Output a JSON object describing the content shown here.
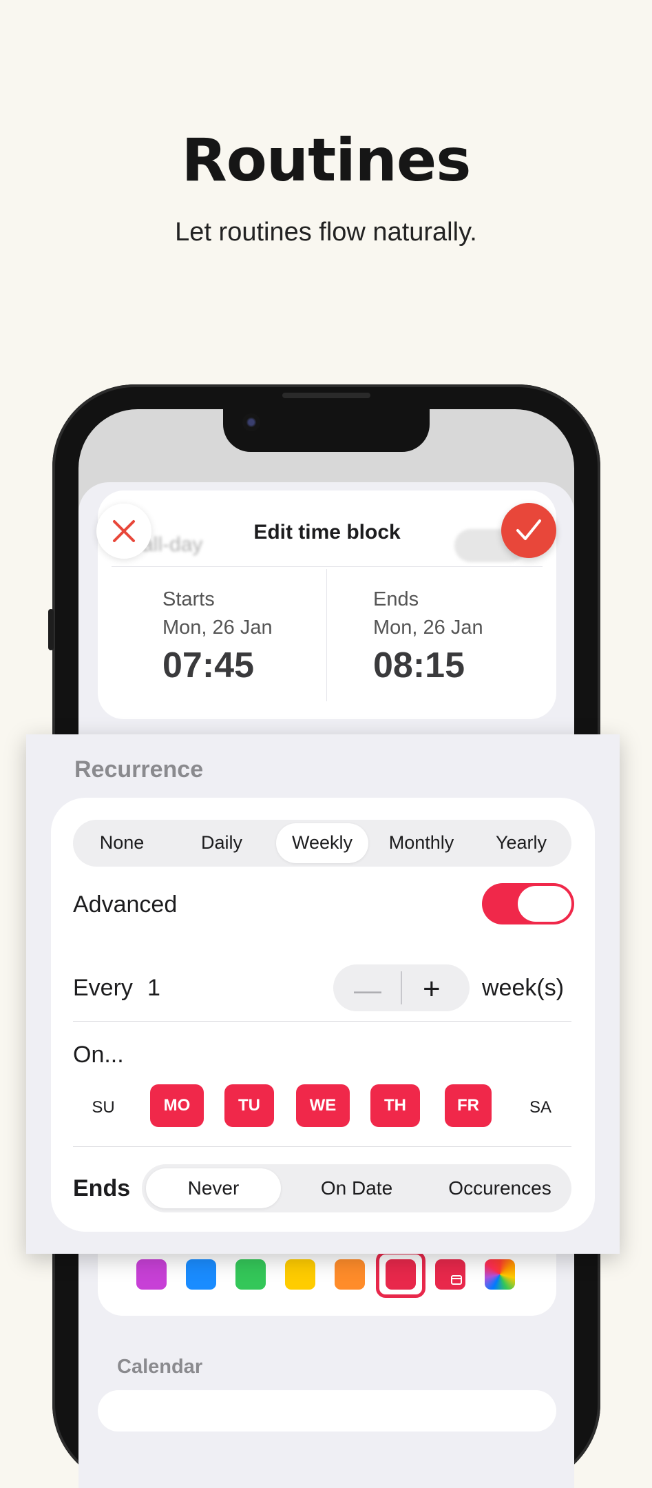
{
  "hero": {
    "title": "Routines",
    "subtitle": "Let routines flow naturally."
  },
  "editor": {
    "title": "Edit time block",
    "background_label": "all-day",
    "starts": {
      "label": "Starts",
      "date": "Mon, 26 Jan",
      "time": "07:45"
    },
    "ends": {
      "label": "Ends",
      "date": "Mon, 26 Jan",
      "time": "08:15"
    },
    "icons": {
      "close": "close-icon",
      "confirm": "checkmark-icon"
    },
    "colors": {
      "close": "#e8473a",
      "confirm": "#e8473a"
    }
  },
  "recurrence": {
    "title": "Recurrence",
    "frequency_options": [
      "None",
      "Daily",
      "Weekly",
      "Monthly",
      "Yearly"
    ],
    "frequency_selected": "Weekly",
    "advanced_label": "Advanced",
    "advanced_enabled": true,
    "every_label": "Every",
    "every_value": "1",
    "every_unit": "week(s)",
    "stepper_minus": "—",
    "stepper_plus": "+",
    "on_label": "On...",
    "days": [
      {
        "label": "SU",
        "selected": false
      },
      {
        "label": "MO",
        "selected": true
      },
      {
        "label": "TU",
        "selected": true
      },
      {
        "label": "WE",
        "selected": true
      },
      {
        "label": "TH",
        "selected": true
      },
      {
        "label": "FR",
        "selected": true
      },
      {
        "label": "SA",
        "selected": false
      }
    ],
    "ends_label": "Ends",
    "ends_options": [
      "Never",
      "On Date",
      "Occurences"
    ],
    "ends_selected": "Never",
    "accent": "#f0284a"
  },
  "color_picker": {
    "swatches": [
      "#c740d6",
      "#1a8cff",
      "#34c759",
      "#ffcc00",
      "#ff8c2a",
      "#e8284b",
      "#e8284b",
      "rainbow"
    ],
    "selected_index": 5
  },
  "calendar_section": {
    "label": "Calendar"
  }
}
